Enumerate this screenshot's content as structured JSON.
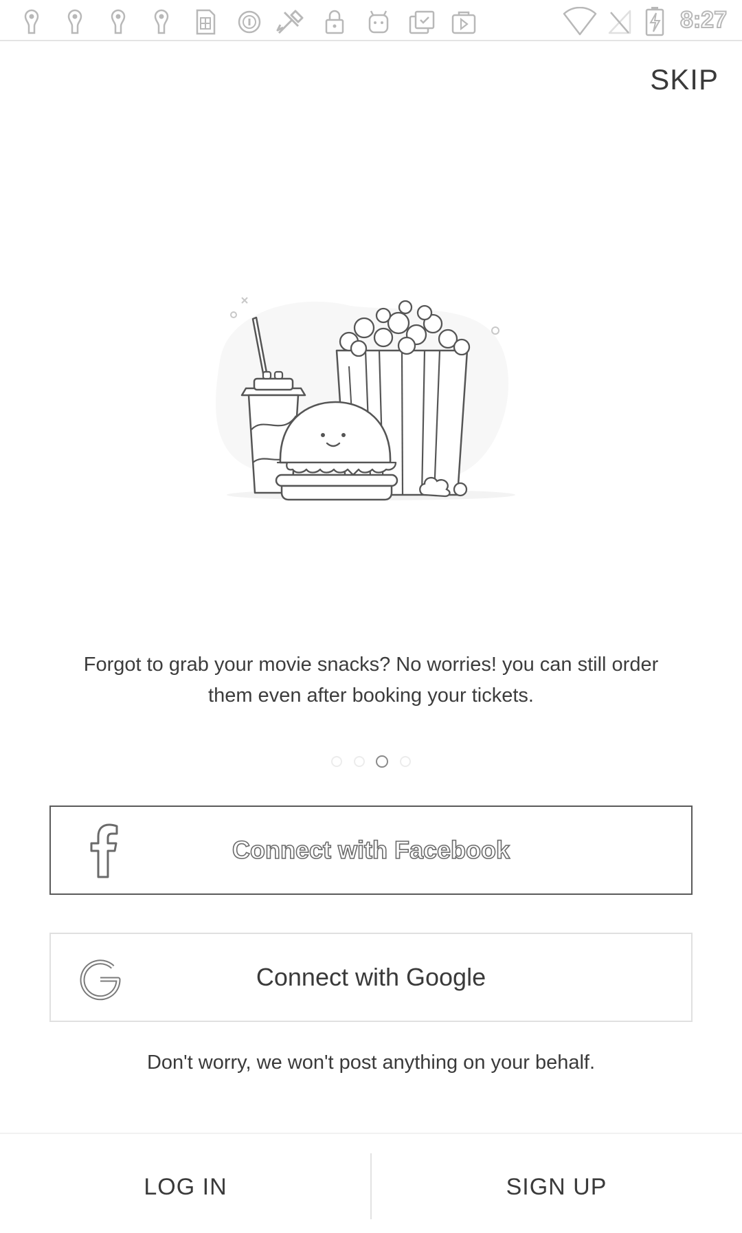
{
  "status_bar": {
    "time": "8:27",
    "left_icons": [
      "person-pin-icon",
      "person-pin-icon",
      "person-pin-icon",
      "person-pin-icon",
      "sim-card-icon",
      "circle-info-icon",
      "tools-icon",
      "lock-icon",
      "android-icon",
      "clipboard-check-icon",
      "play-store-icon"
    ],
    "right_icons": [
      "wifi-icon",
      "no-signal-icon",
      "battery-charging-icon"
    ]
  },
  "header": {
    "skip_label": "SKIP"
  },
  "onboarding": {
    "illustration": "movie-snacks-illustration",
    "caption_line1": "Forgot to grab your movie snacks? No worries! you can still order",
    "caption_line2": "them even after booking your tickets.",
    "page_count": 4,
    "active_page_index": 2
  },
  "auth": {
    "facebook_label": "Connect with Facebook",
    "google_label": "Connect with Google",
    "note": "Don't worry, we won't post anything on your behalf."
  },
  "bottom_bar": {
    "login_label": "LOG IN",
    "signup_label": "SIGN UP"
  },
  "colors": {
    "text": "#3a3a3a",
    "border_active": "#5a5a5a",
    "border_light": "#e0e0e0",
    "background": "#ffffff"
  }
}
